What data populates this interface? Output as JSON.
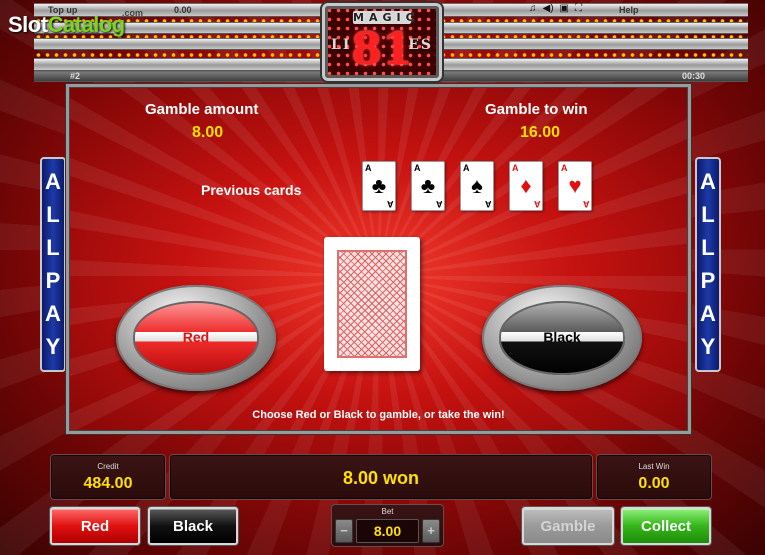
{
  "watermark": {
    "part1": "Slot",
    "part2": "Catalog"
  },
  "top_bar": {
    "top_up_label": "Top up",
    "com_label": ".com",
    "balance": "0.00",
    "help_label": "Help",
    "round_label": "#2",
    "timer": "00:30",
    "icons": [
      "music-icon",
      "speaker-icon",
      "screen-icon",
      "fullscreen-icon"
    ]
  },
  "logo": {
    "magic": "MAGIC",
    "number": "81",
    "lines_left": "LI",
    "lines_right": "ES"
  },
  "gamble": {
    "amount_label": "Gamble amount",
    "amount_value": "8.00",
    "to_win_label": "Gamble to win",
    "to_win_value": "16.00",
    "previous_cards_label": "Previous cards",
    "previous_cards": [
      {
        "rank": "A",
        "suit": "♣",
        "color": "black"
      },
      {
        "rank": "A",
        "suit": "♣",
        "color": "black"
      },
      {
        "rank": "A",
        "suit": "♠",
        "color": "black"
      },
      {
        "rank": "A",
        "suit": "♦",
        "color": "red"
      },
      {
        "rank": "A",
        "suit": "♥",
        "color": "red"
      }
    ],
    "red_choice_label": "Red",
    "black_choice_label": "Black",
    "instruction": "Choose Red or Black to gamble, or take the win!"
  },
  "allpay": {
    "letters": [
      "A",
      "L",
      "L",
      "P",
      "A",
      "Y"
    ]
  },
  "info": {
    "credit_label": "Credit",
    "credit_value": "484.00",
    "win_text": "8.00 won",
    "last_win_label": "Last Win",
    "last_win_value": "0.00"
  },
  "controls": {
    "red_label": "Red",
    "black_label": "Black",
    "bet_label": "Bet",
    "bet_value": "8.00",
    "bet_minus": "−",
    "bet_plus": "+",
    "gamble_label": "Gamble",
    "collect_label": "Collect"
  },
  "colors": {
    "accent_yellow": "#ffe000",
    "background_red": "#c51210",
    "allpay_blue": "#1d3aa8",
    "collect_green": "#35b51a"
  }
}
